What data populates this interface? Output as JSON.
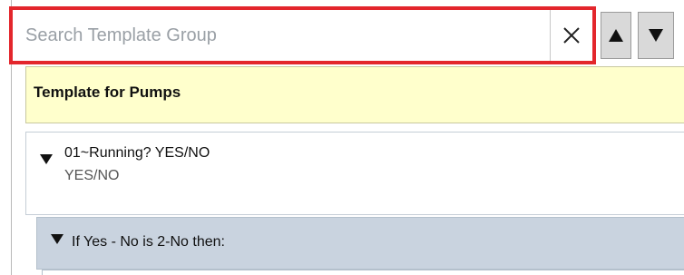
{
  "search": {
    "placeholder": "Search Template Group",
    "value": "",
    "clear_icon": "close-icon"
  },
  "navigation": {
    "up_icon": "triangle-up-icon",
    "down_icon": "triangle-down-icon"
  },
  "template": {
    "title": "Template for Pumps",
    "background": "#ffffcc"
  },
  "questions": [
    {
      "title": "01~Running? YES/NO",
      "subtitle": "YES/NO",
      "expanded": true,
      "conditions": [
        {
          "title": "If Yes - No is 2-No then:",
          "background": "#c9d3df",
          "expanded": true
        }
      ]
    }
  ],
  "colors": {
    "highlight_border": "#e3262c",
    "condition_background": "#c9d3df"
  }
}
